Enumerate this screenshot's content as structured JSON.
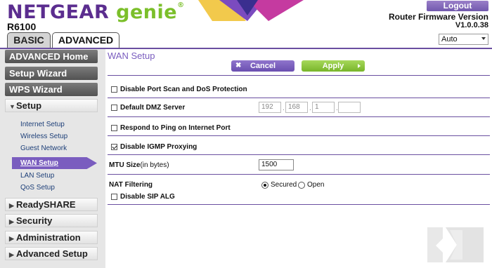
{
  "header": {
    "brand": "NETGEAR",
    "brand_sub": "genie",
    "brand_mark": "®",
    "model": "R6100",
    "logout_label": "Logout",
    "firmware_label": "Router Firmware Version",
    "firmware_version": "V1.0.0.38",
    "language": "Auto"
  },
  "tabs": {
    "basic": "BASIC",
    "advanced": "ADVANCED"
  },
  "sidebar": {
    "advanced_home": "ADVANCED Home",
    "setup_wizard": "Setup Wizard",
    "wps_wizard": "WPS Wizard",
    "setup": "Setup",
    "setup_items": {
      "internet": "Internet Setup",
      "wireless": "Wireless Setup",
      "guest": "Guest Network",
      "wan": "WAN Setup",
      "lan": "LAN Setup",
      "qos": "QoS Setup"
    },
    "readyshare": "ReadySHARE",
    "security": "Security",
    "administration": "Administration",
    "advanced_setup": "Advanced Setup"
  },
  "main": {
    "title": "WAN Setup",
    "cancel_label": "Cancel",
    "apply_label": "Apply",
    "disable_portscan": "Disable Port Scan and DoS Protection",
    "dmz_label": "Default DMZ Server",
    "dmz_ip": [
      "192",
      "168",
      "1",
      ""
    ],
    "ip_sep": ".",
    "respond_ping": "Respond to Ping on Internet Port",
    "disable_igmp": "Disable IGMP Proxying",
    "mtu_label": "MTU Size",
    "mtu_unit": "(in bytes)",
    "mtu_value": "1500",
    "nat_label": "NAT Filtering",
    "nat_secured": "Secured",
    "nat_open": "Open",
    "disable_sip": "Disable SIP ALG"
  },
  "state": {
    "disable_portscan_checked": false,
    "dmz_checked": false,
    "respond_ping_checked": false,
    "disable_igmp_checked": true,
    "nat_filtering": "Secured",
    "disable_sip_checked": false
  },
  "colors": {
    "brand_purple": "#5b2d8f",
    "genie_green": "#7bbf2a",
    "accent_purple": "#7a5dbf",
    "apply_green": "#8cc63f"
  }
}
